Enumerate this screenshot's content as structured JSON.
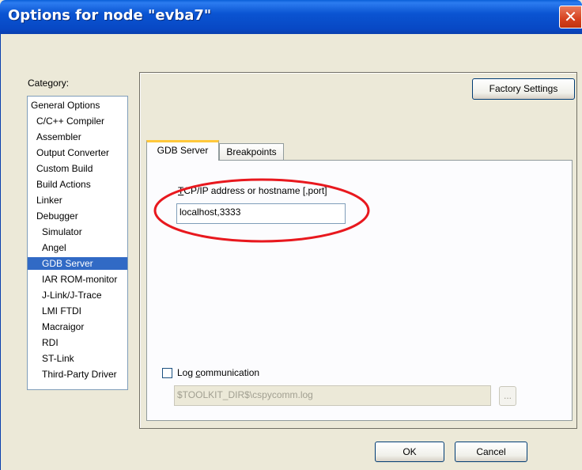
{
  "window": {
    "title": "Options for node \"evba7\"",
    "close_glyph": "✕"
  },
  "category": {
    "label": "Category:",
    "items": [
      {
        "label": "General Options",
        "level": 0
      },
      {
        "label": "C/C++ Compiler",
        "level": 1
      },
      {
        "label": "Assembler",
        "level": 1
      },
      {
        "label": "Output Converter",
        "level": 1
      },
      {
        "label": "Custom Build",
        "level": 1
      },
      {
        "label": "Build Actions",
        "level": 1
      },
      {
        "label": "Linker",
        "level": 1
      },
      {
        "label": "Debugger",
        "level": 1
      },
      {
        "label": "Simulator",
        "level": 2
      },
      {
        "label": "Angel",
        "level": 2
      },
      {
        "label": "GDB Server",
        "level": 2,
        "selected": true
      },
      {
        "label": "IAR ROM-monitor",
        "level": 2
      },
      {
        "label": "J-Link/J-Trace",
        "level": 2
      },
      {
        "label": "LMI FTDI",
        "level": 2
      },
      {
        "label": "Macraigor",
        "level": 2
      },
      {
        "label": "RDI",
        "level": 2
      },
      {
        "label": "ST-Link",
        "level": 2
      },
      {
        "label": "Third-Party Driver",
        "level": 2
      }
    ]
  },
  "panel": {
    "factory_settings_label": "Factory Settings",
    "tabs": [
      {
        "label": "GDB Server",
        "active": true
      },
      {
        "label": "Breakpoints",
        "active": false
      }
    ],
    "gdb_server": {
      "address_label_accel": "T",
      "address_label_rest": "CP/IP address or hostname [,port]",
      "address_value": "localhost,3333",
      "log_checked": false,
      "log_label_pre": "Log ",
      "log_label_accel": "c",
      "log_label_post": "ommunication",
      "log_path": "$TOOLKIT_DIR$\\cspycomm.log",
      "browse_label": "..."
    }
  },
  "footer": {
    "ok_label": "OK",
    "cancel_label": "Cancel"
  },
  "colors": {
    "titlebar": "#0a54d2",
    "selection": "#316ac5",
    "annotation": "#e8181e",
    "tab_accent": "#ffc83c"
  }
}
